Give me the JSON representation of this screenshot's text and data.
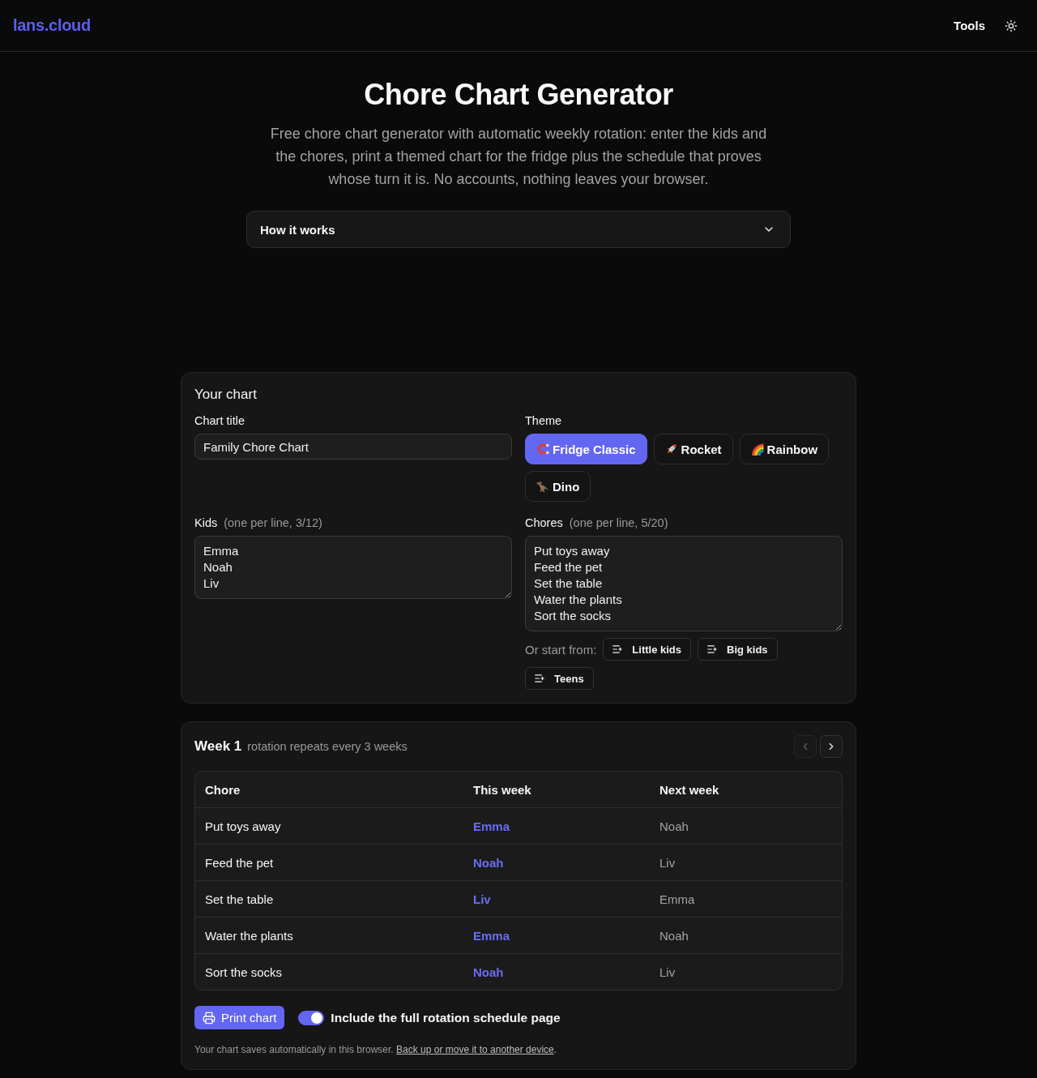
{
  "header": {
    "logo": "lans.cloud",
    "nav": [
      "Tools"
    ]
  },
  "intro": {
    "title": "Chore Chart Generator",
    "text": "Free chore chart generator with automatic weekly rotation: enter the kids and the chores, print a themed chart for the fridge plus the schedule that proves whose turn it is. No accounts, nothing leaves your browser.",
    "accordion": {
      "label": "How it works",
      "expanded": false
    }
  },
  "settings": {
    "heading": "Your chart",
    "chart_title": {
      "label": "Chart title",
      "value": "Family Chore Chart"
    },
    "theme": {
      "label": "Theme",
      "options": [
        {
          "label": "Fridge Classic",
          "kind": "magnet",
          "selected": true
        },
        {
          "label": "Rocket",
          "kind": "rocket",
          "selected": false
        },
        {
          "label": "Rainbow",
          "kind": "rainbow",
          "selected": false
        },
        {
          "label": "Dino",
          "kind": "dinosaur",
          "selected": false
        }
      ]
    },
    "kids": {
      "label": "Kids",
      "hint": "(one per line, 3/12)",
      "lines": [
        "Emma",
        "Noah",
        "Liv"
      ]
    },
    "chores": {
      "label": "Chores",
      "hint": "(one per line, 5/20)",
      "lines": [
        "Put toys away",
        "Feed the pet",
        "Set the table",
        "Water the plants",
        "Sort the socks"
      ]
    },
    "presets": {
      "label": "Or start from:",
      "options": [
        "Little kids",
        "Big kids",
        "Teens"
      ]
    }
  },
  "schedule": {
    "week": "Week 1",
    "note": "rotation repeats every 3 weeks",
    "nav": [
      {
        "kind": "previous",
        "disabled": true
      },
      {
        "kind": "next",
        "disabled": false
      }
    ],
    "table": {
      "columns": [
        "Chore",
        "This week",
        "Next week"
      ],
      "rows": [
        [
          "Put toys away",
          "Emma",
          "Noah"
        ],
        [
          "Feed the pet",
          "Noah",
          "Liv"
        ],
        [
          "Set the table",
          "Liv",
          "Emma"
        ],
        [
          "Water the plants",
          "Emma",
          "Noah"
        ],
        [
          "Sort the socks",
          "Noah",
          "Liv"
        ]
      ]
    }
  },
  "actions": {
    "print": "Print chart",
    "include_schedule": {
      "label": "Include the full rotation schedule page",
      "on": true
    }
  },
  "autosave": {
    "text": "Your chart saves automatically in this browser.",
    "link": "Back up or move it to another device",
    "end": "."
  }
}
